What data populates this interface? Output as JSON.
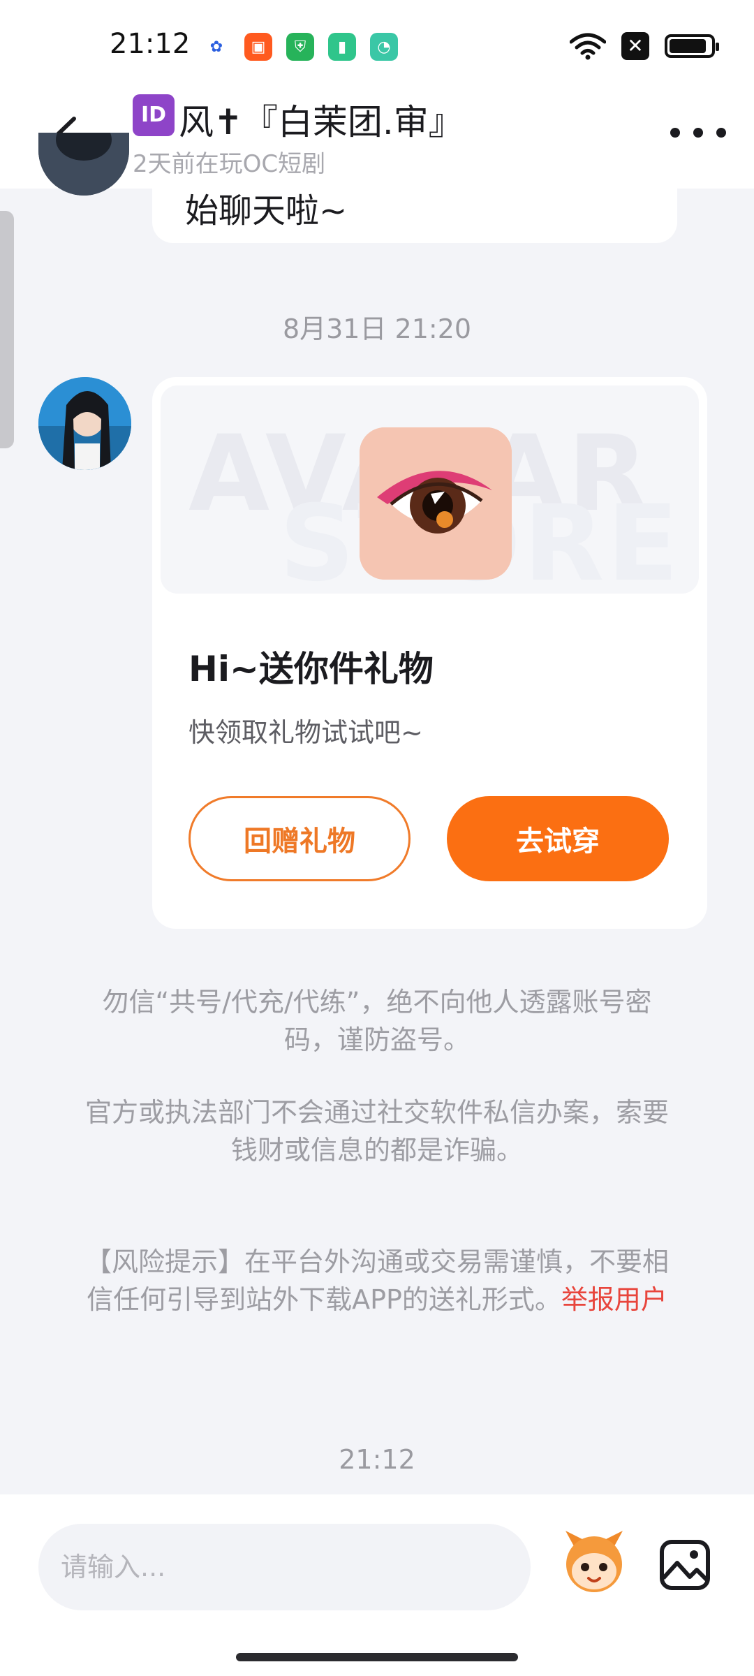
{
  "status_bar": {
    "time": "21:12",
    "app_icons": [
      "baidu-icon",
      "kuaishou-icon",
      "green-shield-icon",
      "battery-app-icon",
      "message-app-icon"
    ],
    "indicators": [
      "wifi-icon",
      "x-icon",
      "battery-icon"
    ]
  },
  "header": {
    "id_badge": "ID",
    "name": "风✝『白茉团.审』",
    "subtitle": "2天前在玩OC短剧",
    "back_icon": "chevron-left-icon",
    "more_icon": "more-horizontal-icon"
  },
  "messages": {
    "previous_text": "始聊天啦~",
    "timestamp": "8月31日 21:20",
    "gift_card": {
      "watermark_line1": "AVATAR",
      "watermark_line2": "STORE",
      "title": "Hi~送你件礼物",
      "description": "快领取礼物试试吧~",
      "return_gift_label": "回赠礼物",
      "try_on_label": "去试穿"
    }
  },
  "notices": {
    "fraud_1": "勿信“共号/代充/代练”，绝不向他人透露账号密码，谨防盗号。",
    "fraud_2": "官方或执法部门不会通过社交软件私信办案，索要钱财或信息的都是诈骗。",
    "risk": "【风险提示】在平台外沟通或交易需谨慎，不要相信任何引导到站外下载APP的送礼形式。",
    "report_link": "举报用户"
  },
  "bottom_timestamp": "21:12",
  "input": {
    "placeholder": "请输入..."
  },
  "colors": {
    "accent": "#fb6f12",
    "report": "#e8453c",
    "background": "#f3f4f8"
  }
}
